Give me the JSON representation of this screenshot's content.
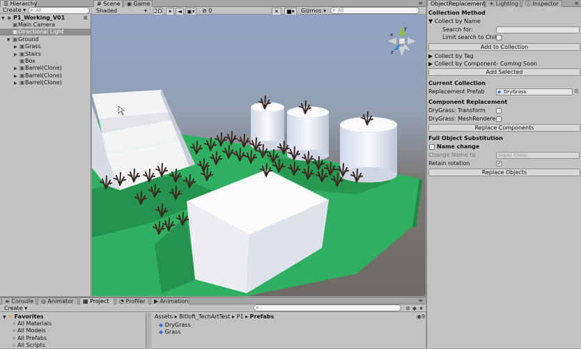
{
  "hierarchy": {
    "tab": "Hierarchy",
    "create": "Create",
    "search_placeholder": "All",
    "scene": "P1_Working_V01",
    "items": [
      {
        "label": "Main Camera",
        "indent": 1,
        "arrow": "",
        "selected": false
      },
      {
        "label": "Directional Light",
        "indent": 1,
        "arrow": "",
        "selected": true
      },
      {
        "label": "Ground",
        "indent": 1,
        "arrow": "▼",
        "selected": false
      },
      {
        "label": "Grass",
        "indent": 2,
        "arrow": "▶",
        "selected": false
      },
      {
        "label": "Stairs",
        "indent": 2,
        "arrow": "▶",
        "selected": false
      },
      {
        "label": "Box",
        "indent": 2,
        "arrow": "",
        "selected": false
      },
      {
        "label": "Barrel(Clone)",
        "indent": 2,
        "arrow": "▶",
        "selected": false
      },
      {
        "label": "Barrel(Clone)",
        "indent": 2,
        "arrow": "▶",
        "selected": false
      },
      {
        "label": "Barrel(Clone)",
        "indent": 2,
        "arrow": "▶",
        "selected": false
      }
    ]
  },
  "scene_view": {
    "tabs": [
      "Scene",
      "Game"
    ],
    "shading": "Shaded",
    "mode_2d": "2D",
    "fx_count": "0",
    "gizmos": "Gizmos",
    "search_placeholder": "All",
    "gizmo_axes": {
      "x": "x",
      "y": "y",
      "z": "z"
    }
  },
  "inspector": {
    "tabs": [
      "ObjectReplacement",
      "Lighting",
      "Inspector"
    ],
    "collection_method": "Collection Method",
    "collect_by_name": "Collect by Name",
    "search_for": "Search for:",
    "search_for_value": "",
    "limit_children": "Limit search to Childr",
    "add_to_collection": "Add to Collection",
    "collect_by_tag": "Collect by Tag",
    "collect_by_component": "Collect by Component- Coming Soon",
    "add_selected": "Add Selected",
    "current_collection": "Current Collection",
    "replacement_prefab": "Replacement Prefab",
    "replacement_prefab_value": "DryGrass",
    "component_replacement": "Component Replacement",
    "dg_transform": "DryGrass: Transform",
    "dg_meshrenderer": "DryGrass: MeshRenderer",
    "replace_components": "Replace Components",
    "full_object_substitution": "Full Object Substitution",
    "name_change": "Name change",
    "change_name_to": "Change Name to",
    "change_name_placeholder": "Super Grass",
    "retain_rotation": "Retain rotation",
    "retain_rotation_checked": true,
    "replace_objects": "Replace Objects"
  },
  "bottom": {
    "tabs": [
      "Console",
      "Animator",
      "Project",
      "Profiler",
      "Animation"
    ],
    "create": "Create",
    "favorites": "Favorites",
    "favorite_items": [
      "All Materials",
      "All Models",
      "All Prefabs",
      "All Scripts"
    ],
    "breadcrumb": [
      "Assets",
      "Bitloft_TechArtTest",
      "P1",
      "Prefabs"
    ],
    "assets": [
      "DryGrass",
      "Grass"
    ],
    "badge_count": "9"
  },
  "colors": {
    "ground": "#2fb060",
    "sky_top": "#8ea3c4",
    "horizon": "#6f6a64",
    "selection": "#8e8e8e",
    "accent": "#3a6fd8"
  }
}
